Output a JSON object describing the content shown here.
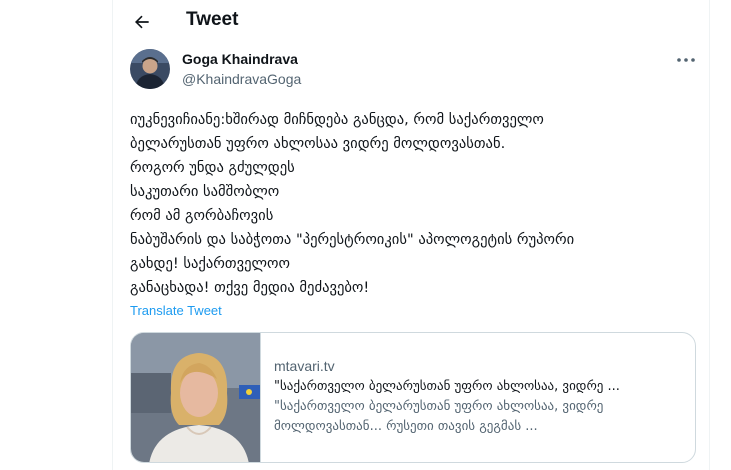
{
  "header": {
    "title": "Tweet",
    "back_icon": "arrow-left-icon"
  },
  "author": {
    "name": "Goga Khaindrava",
    "handle": "@KhaindravaGoga"
  },
  "tweet": {
    "lines": [
      "იუკნევიჩიანე:ხშირად მიჩნდება განცდა, რომ საქართველო",
      "ბელარუსთან უფრო ახლოსაა ვიდრე მოლდოვასთან.",
      "როგორ უნდა გძულდეს",
      "საკუთარი სამშობლო",
      "რომ ამ გორბაჩოვის",
      "ნაბუშარის და საბჭოთა \"პერესტროიკის\" აპოლოგეტის რუპორი",
      "გახდე! საქართველოო",
      "განაცხადა! თქვე მედია მეძავებო!"
    ],
    "translate_label": "Translate Tweet"
  },
  "card": {
    "domain": "mtavari.tv",
    "title": "\"საქართველო ბელარუსთან უფრო ახლოსაა, ვიდრე ...",
    "description_lines": [
      "\"საქართველო ბელარუსთან უფრო ახლოსაა, ვიდრე",
      "მოლდოვასთან... რუსეთი თავის გეგმას ..."
    ]
  },
  "colors": {
    "link": "#1d9bf0",
    "secondary_text": "#536471",
    "border": "#cfd9de"
  }
}
